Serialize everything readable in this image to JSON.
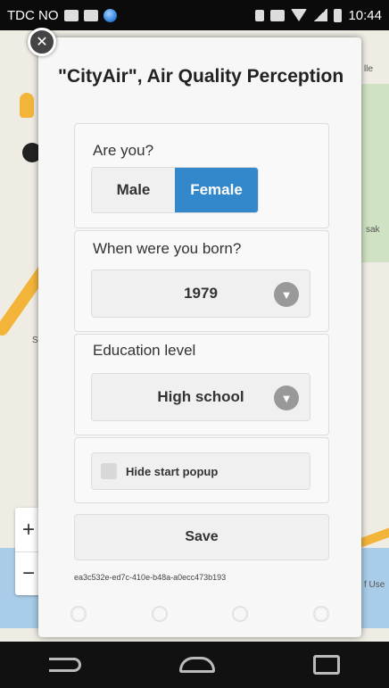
{
  "status_bar": {
    "carrier": "TDC NO",
    "time": "10:44"
  },
  "map": {
    "labels": [
      "lle",
      "Sk",
      "sak",
      "f Use"
    ]
  },
  "popup": {
    "title": "\"CityAir\", Air Quality Perception",
    "gender": {
      "label": "Are you?",
      "options": [
        "Male",
        "Female"
      ],
      "selected": "Female"
    },
    "birth_year": {
      "label": "When were you born?",
      "value": "1979"
    },
    "education": {
      "label": "Education level",
      "value": "High school"
    },
    "hide_popup": {
      "label": "Hide start popup",
      "checked": false
    },
    "save_label": "Save",
    "device_id": "ea3c532e-ed7c-410e-b48a-a0ecc473b193"
  },
  "map_controls": {
    "zoom_in": "+",
    "zoom_out": "−"
  },
  "colors": {
    "accent": "#3388cc",
    "status_bar": "#0b0b0b",
    "nav_bar": "#111111"
  }
}
